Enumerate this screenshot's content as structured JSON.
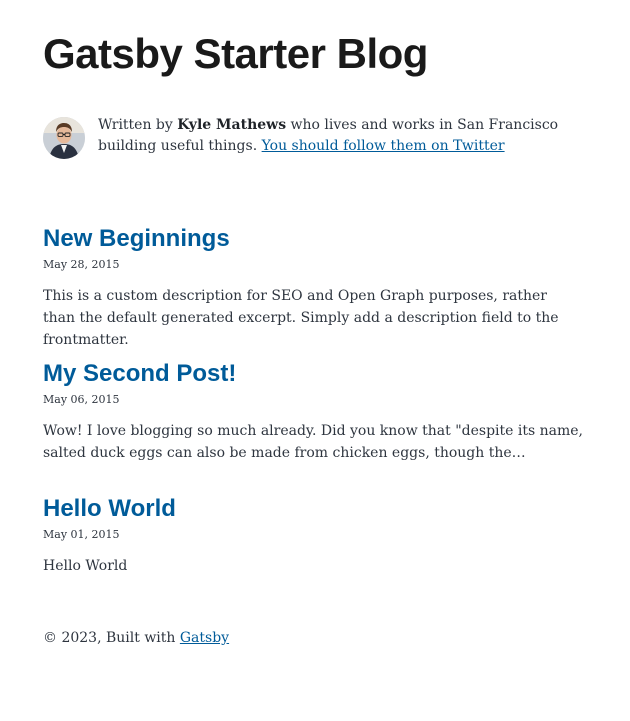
{
  "site": {
    "title": "Gatsby Starter Blog"
  },
  "bio": {
    "prefix": "Written by ",
    "author": "Kyle Mathews",
    "suffix": " who lives and works in San Francisco building useful things. ",
    "follow_link": "You should follow them on Twitter"
  },
  "posts": [
    {
      "title": "New Beginnings",
      "date": "May 28, 2015",
      "excerpt": "This is a custom description for SEO and Open Graph purposes, rather than the default generated excerpt. Simply add a description field to the frontmatter."
    },
    {
      "title": "My Second Post!",
      "date": "May 06, 2015",
      "excerpt": "Wow! I love blogging so much already. Did you know that \"despite its name, salted duck eggs can also be made from chicken eggs, though the…"
    },
    {
      "title": "Hello World",
      "date": "May 01, 2015",
      "excerpt": "Hello World"
    }
  ],
  "footer": {
    "prefix": "© 2023, Built with ",
    "link": "Gatsby"
  },
  "colors": {
    "accent": "#005b99",
    "text": "#2e353f",
    "heading": "#1a1a1a"
  },
  "icons": {
    "avatar": "profile-photo"
  }
}
